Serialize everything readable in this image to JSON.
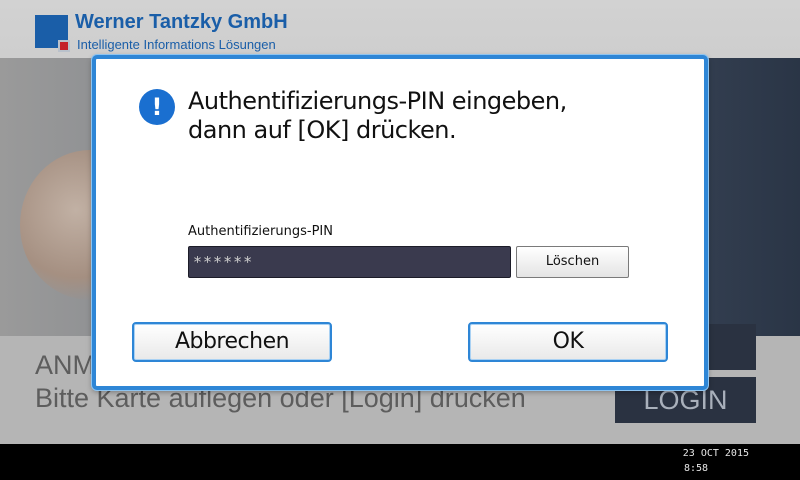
{
  "background": {
    "brand_name": "Werner Tantzky GmbH",
    "brand_subtitle": "Intelligente Informations Lösungen",
    "title_partial": "ANM",
    "instruction": "Bitte Karte auflegen oder [Login] drücken",
    "login_button": "LOGIN"
  },
  "dialog": {
    "message_line1": "Authentifizierungs-PIN eingeben,",
    "message_line2": "dann auf [OK] drücken.",
    "icon": "exclamation-icon",
    "pin_label": "Authentifizierungs-PIN",
    "pin_value": "******",
    "clear_label": "Löschen",
    "cancel_label": "Abbrechen",
    "ok_label": "OK",
    "colors": {
      "frame": "#2e86d6",
      "icon": "#1a6fd0",
      "input_bg": "#3a3a4e"
    }
  },
  "status_bar": {
    "date": "23 OCT  2015",
    "time": "8:58"
  }
}
